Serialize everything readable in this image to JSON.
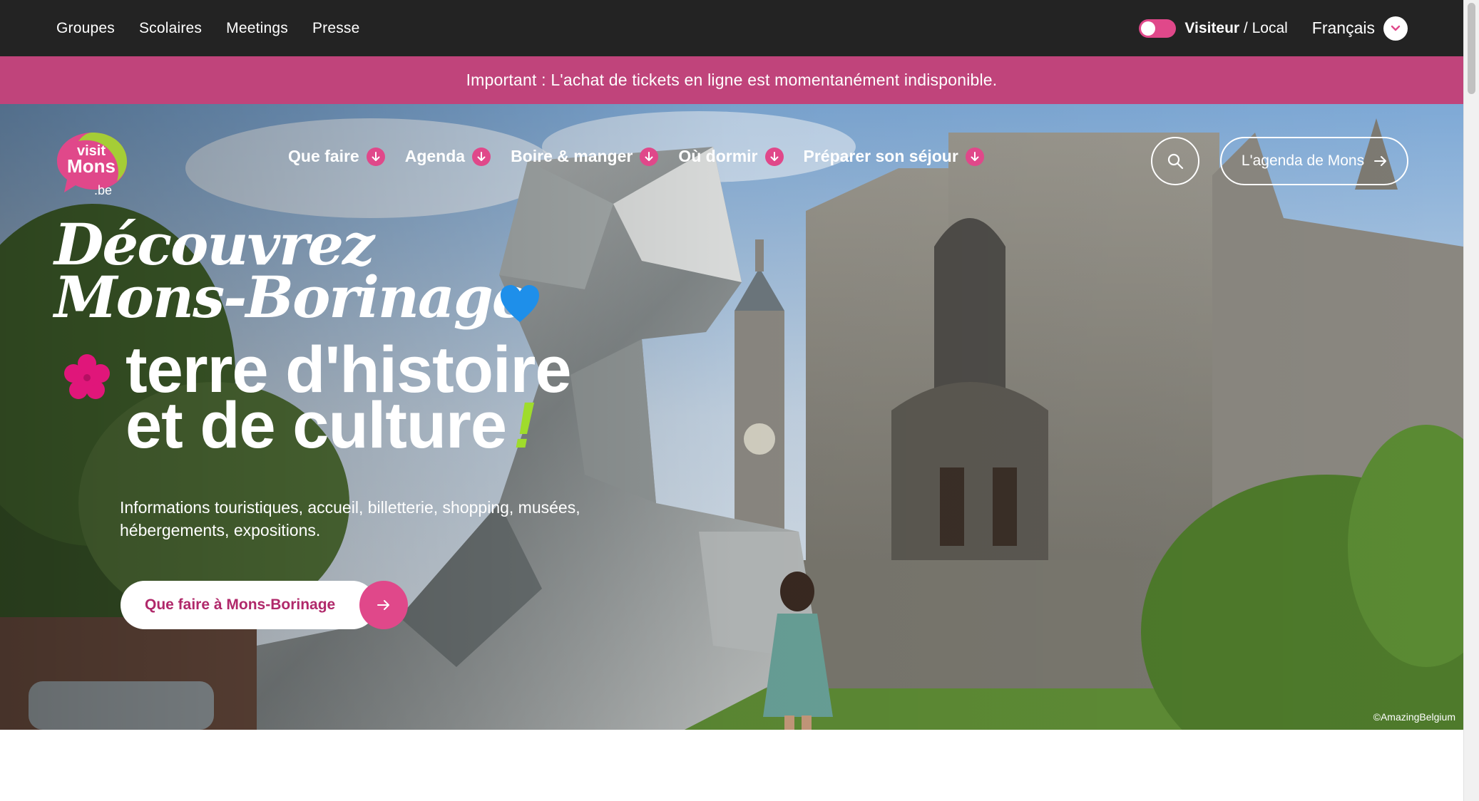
{
  "topbar": {
    "links": [
      "Groupes",
      "Scolaires",
      "Meetings",
      "Presse"
    ],
    "mode_active": "Visiteur",
    "mode_separator": " / ",
    "mode_other": "Local",
    "language": "Français"
  },
  "alert": {
    "text": "Important : L'achat de tickets en ligne est momentanément indisponible."
  },
  "logo": {
    "line1": "visit",
    "line2": "Mons",
    "line3": ".be"
  },
  "nav": {
    "items": [
      "Que faire",
      "Agenda",
      "Boire & manger",
      "Où dormir",
      "Préparer son séjour"
    ]
  },
  "header_actions": {
    "agenda_button": "L'agenda de Mons"
  },
  "hero": {
    "script_line1": "Découvrez",
    "script_line2": "Mons-Borinage",
    "tagline_line1": "terre d'histoire",
    "tagline_line2": "et de culture",
    "exclamation": "!",
    "description": "Informations touristiques, accueil, billetterie, shopping, musées, hébergements, expositions.",
    "cta_label": "Que faire à Mons-Borinage",
    "photo_credit": "©AmazingBelgium"
  },
  "colors": {
    "topbar_bg": "#232323",
    "accent_pink": "#e0488a",
    "alert_bg": "#c0447b",
    "cta_text": "#b0286a",
    "heart_blue": "#1e8fea",
    "exclamation_green": "#9fdc2c"
  },
  "icons": {
    "nav_dropdown": "arrow-down-icon",
    "search": "search-icon",
    "agenda_arrow": "arrow-right-icon",
    "language": "chevron-down-icon",
    "decor_heart": "heart-icon",
    "decor_flower": "flower-icon"
  }
}
